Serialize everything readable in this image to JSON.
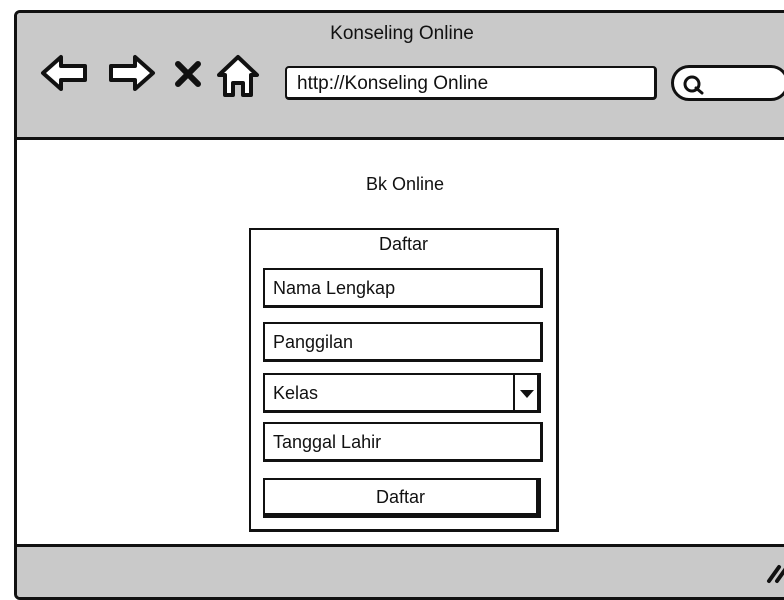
{
  "window": {
    "title": "Konseling Online"
  },
  "toolbar": {
    "back_icon": "arrow-left-icon",
    "forward_icon": "arrow-right-icon",
    "stop_icon": "close-icon",
    "home_icon": "home-icon",
    "url": "http://Konseling Online",
    "search_icon": "search-icon"
  },
  "page": {
    "title": "Bk Online"
  },
  "form": {
    "title": "Daftar",
    "fields": {
      "name": "Nama Lengkap",
      "nickname": "Panggilan",
      "class": "Kelas",
      "birthdate": "Tanggal Lahir"
    },
    "submit_label": "Daftar"
  },
  "colors": {
    "chrome": "#c9c9c9",
    "border": "#111111",
    "background": "#ffffff"
  }
}
